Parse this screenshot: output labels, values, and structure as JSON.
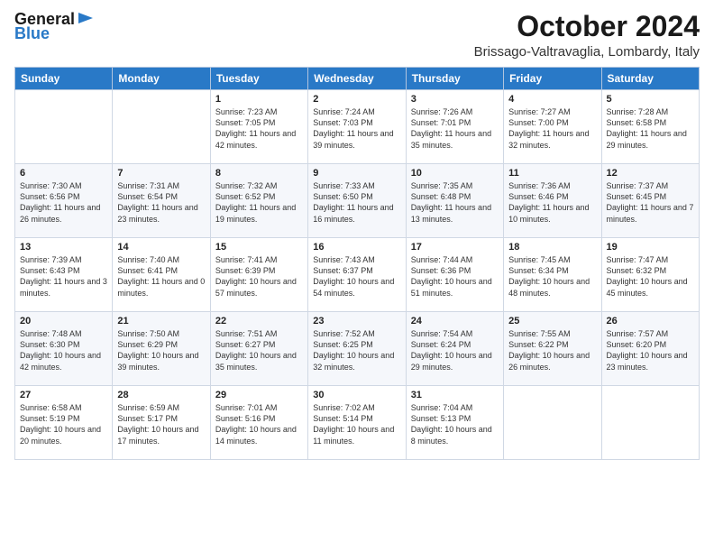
{
  "header": {
    "logo_general": "General",
    "logo_blue": "Blue",
    "month_title": "October 2024",
    "location": "Brissago-Valtravaglia, Lombardy, Italy"
  },
  "days_of_week": [
    "Sunday",
    "Monday",
    "Tuesday",
    "Wednesday",
    "Thursday",
    "Friday",
    "Saturday"
  ],
  "weeks": [
    [
      {
        "day": "",
        "sunrise": "",
        "sunset": "",
        "daylight": ""
      },
      {
        "day": "",
        "sunrise": "",
        "sunset": "",
        "daylight": ""
      },
      {
        "day": "1",
        "sunrise": "Sunrise: 7:23 AM",
        "sunset": "Sunset: 7:05 PM",
        "daylight": "Daylight: 11 hours and 42 minutes."
      },
      {
        "day": "2",
        "sunrise": "Sunrise: 7:24 AM",
        "sunset": "Sunset: 7:03 PM",
        "daylight": "Daylight: 11 hours and 39 minutes."
      },
      {
        "day": "3",
        "sunrise": "Sunrise: 7:26 AM",
        "sunset": "Sunset: 7:01 PM",
        "daylight": "Daylight: 11 hours and 35 minutes."
      },
      {
        "day": "4",
        "sunrise": "Sunrise: 7:27 AM",
        "sunset": "Sunset: 7:00 PM",
        "daylight": "Daylight: 11 hours and 32 minutes."
      },
      {
        "day": "5",
        "sunrise": "Sunrise: 7:28 AM",
        "sunset": "Sunset: 6:58 PM",
        "daylight": "Daylight: 11 hours and 29 minutes."
      }
    ],
    [
      {
        "day": "6",
        "sunrise": "Sunrise: 7:30 AM",
        "sunset": "Sunset: 6:56 PM",
        "daylight": "Daylight: 11 hours and 26 minutes."
      },
      {
        "day": "7",
        "sunrise": "Sunrise: 7:31 AM",
        "sunset": "Sunset: 6:54 PM",
        "daylight": "Daylight: 11 hours and 23 minutes."
      },
      {
        "day": "8",
        "sunrise": "Sunrise: 7:32 AM",
        "sunset": "Sunset: 6:52 PM",
        "daylight": "Daylight: 11 hours and 19 minutes."
      },
      {
        "day": "9",
        "sunrise": "Sunrise: 7:33 AM",
        "sunset": "Sunset: 6:50 PM",
        "daylight": "Daylight: 11 hours and 16 minutes."
      },
      {
        "day": "10",
        "sunrise": "Sunrise: 7:35 AM",
        "sunset": "Sunset: 6:48 PM",
        "daylight": "Daylight: 11 hours and 13 minutes."
      },
      {
        "day": "11",
        "sunrise": "Sunrise: 7:36 AM",
        "sunset": "Sunset: 6:46 PM",
        "daylight": "Daylight: 11 hours and 10 minutes."
      },
      {
        "day": "12",
        "sunrise": "Sunrise: 7:37 AM",
        "sunset": "Sunset: 6:45 PM",
        "daylight": "Daylight: 11 hours and 7 minutes."
      }
    ],
    [
      {
        "day": "13",
        "sunrise": "Sunrise: 7:39 AM",
        "sunset": "Sunset: 6:43 PM",
        "daylight": "Daylight: 11 hours and 3 minutes."
      },
      {
        "day": "14",
        "sunrise": "Sunrise: 7:40 AM",
        "sunset": "Sunset: 6:41 PM",
        "daylight": "Daylight: 11 hours and 0 minutes."
      },
      {
        "day": "15",
        "sunrise": "Sunrise: 7:41 AM",
        "sunset": "Sunset: 6:39 PM",
        "daylight": "Daylight: 10 hours and 57 minutes."
      },
      {
        "day": "16",
        "sunrise": "Sunrise: 7:43 AM",
        "sunset": "Sunset: 6:37 PM",
        "daylight": "Daylight: 10 hours and 54 minutes."
      },
      {
        "day": "17",
        "sunrise": "Sunrise: 7:44 AM",
        "sunset": "Sunset: 6:36 PM",
        "daylight": "Daylight: 10 hours and 51 minutes."
      },
      {
        "day": "18",
        "sunrise": "Sunrise: 7:45 AM",
        "sunset": "Sunset: 6:34 PM",
        "daylight": "Daylight: 10 hours and 48 minutes."
      },
      {
        "day": "19",
        "sunrise": "Sunrise: 7:47 AM",
        "sunset": "Sunset: 6:32 PM",
        "daylight": "Daylight: 10 hours and 45 minutes."
      }
    ],
    [
      {
        "day": "20",
        "sunrise": "Sunrise: 7:48 AM",
        "sunset": "Sunset: 6:30 PM",
        "daylight": "Daylight: 10 hours and 42 minutes."
      },
      {
        "day": "21",
        "sunrise": "Sunrise: 7:50 AM",
        "sunset": "Sunset: 6:29 PM",
        "daylight": "Daylight: 10 hours and 39 minutes."
      },
      {
        "day": "22",
        "sunrise": "Sunrise: 7:51 AM",
        "sunset": "Sunset: 6:27 PM",
        "daylight": "Daylight: 10 hours and 35 minutes."
      },
      {
        "day": "23",
        "sunrise": "Sunrise: 7:52 AM",
        "sunset": "Sunset: 6:25 PM",
        "daylight": "Daylight: 10 hours and 32 minutes."
      },
      {
        "day": "24",
        "sunrise": "Sunrise: 7:54 AM",
        "sunset": "Sunset: 6:24 PM",
        "daylight": "Daylight: 10 hours and 29 minutes."
      },
      {
        "day": "25",
        "sunrise": "Sunrise: 7:55 AM",
        "sunset": "Sunset: 6:22 PM",
        "daylight": "Daylight: 10 hours and 26 minutes."
      },
      {
        "day": "26",
        "sunrise": "Sunrise: 7:57 AM",
        "sunset": "Sunset: 6:20 PM",
        "daylight": "Daylight: 10 hours and 23 minutes."
      }
    ],
    [
      {
        "day": "27",
        "sunrise": "Sunrise: 6:58 AM",
        "sunset": "Sunset: 5:19 PM",
        "daylight": "Daylight: 10 hours and 20 minutes."
      },
      {
        "day": "28",
        "sunrise": "Sunrise: 6:59 AM",
        "sunset": "Sunset: 5:17 PM",
        "daylight": "Daylight: 10 hours and 17 minutes."
      },
      {
        "day": "29",
        "sunrise": "Sunrise: 7:01 AM",
        "sunset": "Sunset: 5:16 PM",
        "daylight": "Daylight: 10 hours and 14 minutes."
      },
      {
        "day": "30",
        "sunrise": "Sunrise: 7:02 AM",
        "sunset": "Sunset: 5:14 PM",
        "daylight": "Daylight: 10 hours and 11 minutes."
      },
      {
        "day": "31",
        "sunrise": "Sunrise: 7:04 AM",
        "sunset": "Sunset: 5:13 PM",
        "daylight": "Daylight: 10 hours and 8 minutes."
      },
      {
        "day": "",
        "sunrise": "",
        "sunset": "",
        "daylight": ""
      },
      {
        "day": "",
        "sunrise": "",
        "sunset": "",
        "daylight": ""
      }
    ]
  ]
}
